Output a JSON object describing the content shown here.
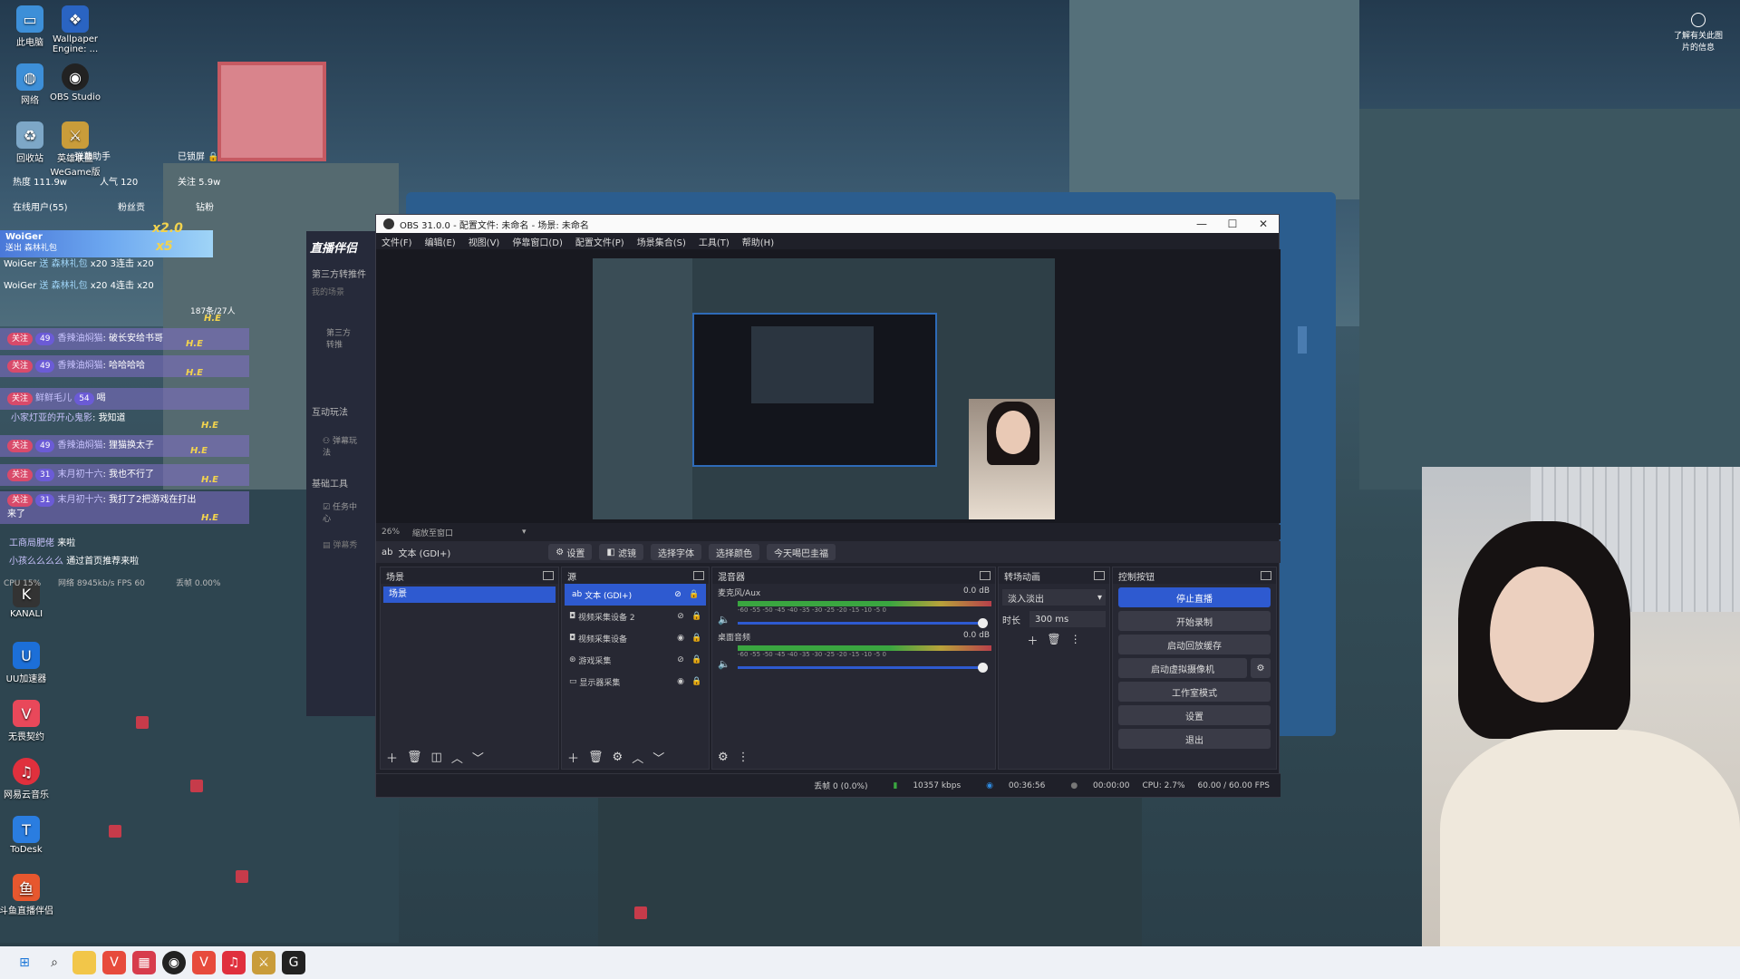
{
  "desktop": {
    "icons": [
      {
        "label": "此电脑",
        "icon": "computer-icon"
      },
      {
        "label": "Wallpaper Engine: ...",
        "icon": "wallpaper-engine-icon"
      },
      {
        "label": "网络",
        "icon": "network-icon"
      },
      {
        "label": "OBS Studio",
        "icon": "obs-icon"
      },
      {
        "label": "回收站",
        "icon": "recycle-bin-icon"
      },
      {
        "label": "英雄联盟WeGame版",
        "icon": "wegame-icon"
      },
      {
        "label": "KANALI",
        "icon": "kanali-icon"
      },
      {
        "label": "UU加速器",
        "icon": "uu-icon"
      },
      {
        "label": "无畏契约",
        "icon": "valorant-icon"
      },
      {
        "label": "网易云音乐",
        "icon": "netease-music-icon"
      },
      {
        "label": "ToDesk",
        "icon": "todesk-icon"
      },
      {
        "label": "斗鱼直播伴侣",
        "icon": "douyu-icon"
      }
    ],
    "top_right_label": "了解有关此图片的信息"
  },
  "stream_overlay": {
    "assistant": "弹幕助手",
    "locked": "已锁屏",
    "heat": "热度 111.9w",
    "popularity": "人气 120",
    "follows": "关注 5.9w",
    "online_users": "在线用户(55)",
    "fans": "粉丝贡",
    "gift_btn": "钻粉",
    "gift_user": "WoiGer",
    "gift_sub": "送出 森林礼包",
    "gift_mult1": "x2.0",
    "gift_mult2": "x5",
    "gift_lines": [
      {
        "user": "WoiGer",
        "text": "送 森林礼包",
        "combo": "x20 3连击 x20"
      },
      {
        "user": "WoiGer",
        "text": "送 森林礼包",
        "combo": "x20 4连击 x20"
      }
    ],
    "chat": [
      {
        "badge": "关注",
        "level": "49",
        "user": "香辣油焖猫",
        "msg": "破长安给书哥"
      },
      {
        "badge": "关注",
        "level": "49",
        "user": "香辣油焖猫",
        "msg": "哈哈哈哈"
      },
      {
        "badge": "关注",
        "level": "54",
        "user": "鲜鲜毛儿",
        "msg": "喝"
      },
      {
        "badge": "",
        "level": "",
        "user": "小家灯亚的开心鬼影",
        "msg": "我知道"
      },
      {
        "badge": "关注",
        "level": "49",
        "user": "香辣油焖猫",
        "msg": "狸猫换太子"
      },
      {
        "badge": "关注",
        "level": "31",
        "user": "末月初十六",
        "msg": "我也不行了"
      },
      {
        "badge": "关注",
        "level": "31",
        "user": "末月初十六",
        "msg": "我打了2把游戏在打出来了"
      }
    ],
    "notice1_user": "工商局肥佬",
    "notice1_text": "来啦",
    "notice2_user": "小孩么么么么",
    "notice2_text": "通过首页推荐来啦",
    "he_tag": "H.E",
    "cpu_line": "CPU 15%",
    "net_line": "网络 8945kb/s FPS 60",
    "drop_line": "丢帧 0.00%",
    "room_count": "187条/27人"
  },
  "live_panel": {
    "brand": "直播伴侣",
    "section1": "第三方转推件",
    "item1": "我的场景",
    "item2": "第三方转推",
    "section2": "互动玩法",
    "item3": "弹幕玩法",
    "section3": "基础工具",
    "item4": "任务中心",
    "item5": "弹幕秀"
  },
  "obs": {
    "title": "OBS 31.0.0 - 配置文件: 未命名 - 场景: 未命名",
    "menu": [
      "文件(F)",
      "编辑(E)",
      "视图(V)",
      "停靠窗口(D)",
      "配置文件(P)",
      "场景集合(S)",
      "工具(T)",
      "帮助(H)"
    ],
    "zoom": "26%",
    "zoom_label": "縮放至窗口",
    "source_name": "文本 (GDI+)",
    "source_buttons": [
      "设置",
      "滤镜",
      "选择字体",
      "选择颜色",
      "今天喝巴圭福"
    ],
    "scenes_title": "场景",
    "scenes": [
      "场景"
    ],
    "sources_title": "源",
    "sources": [
      {
        "name": "文本 (GDI+)",
        "visible": "hidden",
        "locked": true
      },
      {
        "name": "视频采集设备 2",
        "visible": "hidden",
        "locked": true
      },
      {
        "name": "视频采集设备",
        "visible": "visible",
        "locked": true
      },
      {
        "name": "游戏采集",
        "visible": "hidden",
        "locked": true
      },
      {
        "name": "显示器采集",
        "visible": "visible",
        "locked": true
      }
    ],
    "mixer_title": "混音器",
    "mixer": [
      {
        "name": "麦克风/Aux",
        "db": "0.0 dB"
      },
      {
        "name": "桌面音频",
        "db": "0.0 dB"
      }
    ],
    "meter_ticks": "-60 -55 -50 -45 -40 -35 -30 -25 -20 -15 -10 -5 0",
    "transitions_title": "转场动画",
    "transition": "淡入淡出",
    "duration_label": "时长",
    "duration": "300 ms",
    "controls_title": "控制按钮",
    "controls": [
      "停止直播",
      "开始录制",
      "启动回放缓存",
      "启动虚拟摄像机",
      "工作室模式",
      "设置",
      "退出"
    ],
    "status": {
      "dropped": "丢帧 0 (0.0%)",
      "bitrate": "10357 kbps",
      "live_time": "00:36:56",
      "rec_time": "00:00:00",
      "cpu": "CPU: 2.7%",
      "fps": "60.00 / 60.00 FPS"
    }
  },
  "colors": {
    "accent": "#2e5ad0",
    "obs_bg": "#1f2029",
    "taskbar": "#eef1f6"
  }
}
